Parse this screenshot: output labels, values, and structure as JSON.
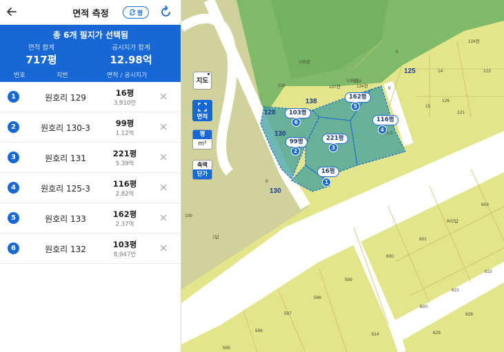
{
  "header": {
    "title": "면적 측정",
    "unit_toggle_label": "평"
  },
  "summary": {
    "title": "총 6개 필지가 선택됨",
    "area_label": "면적 합계",
    "area_value": "717평",
    "price_label": "공시지가 합계",
    "price_value": "12.98억",
    "col_number": "번호",
    "col_jibun": "지번",
    "col_area_price": "면적 / 공시지가"
  },
  "parcels": [
    {
      "number": "1",
      "jibun": "원호리 129",
      "area": "16평",
      "price": "3,910만"
    },
    {
      "number": "2",
      "jibun": "원호리 130-3",
      "area": "99평",
      "price": "1.12억"
    },
    {
      "number": "3",
      "jibun": "원호리 131",
      "area": "221평",
      "price": "5.39억"
    },
    {
      "number": "4",
      "jibun": "원호리 125-3",
      "area": "116평",
      "price": "2.82억"
    },
    {
      "number": "5",
      "jibun": "원호리 133",
      "area": "162평",
      "price": "2.37억"
    },
    {
      "number": "6",
      "jibun": "원호리 132",
      "area": "103평",
      "price": "8,947만"
    }
  ],
  "map_controls": {
    "map_button": "지도",
    "area_button": "면적",
    "unit_selected": "평",
    "unit_other": "m²",
    "zoom_top": "축액",
    "zoom_bottom": "단가"
  },
  "map_labels": {
    "block_128": "128",
    "block_138": "138",
    "block_130": "130",
    "block_125": "125",
    "block_130_road": "130",
    "lot_135": "135전",
    "lot_137": "137전",
    "lot_138_small": "138",
    "lot_123": "123",
    "lot_124": "124전",
    "lot_14": "14",
    "lot_125_3": "125-3",
    "lot_126": "126",
    "lot_121": "121",
    "lot_603": "603",
    "lot_602": "602답",
    "lot_601": "601",
    "lot_600": "600",
    "lot_599": "599",
    "lot_598": "598",
    "lot_597": "597",
    "lot_596": "596",
    "lot_595": "595",
    "lot_614": "614",
    "lot_620": "620",
    "lot_621": "621",
    "lot_622": "622",
    "lot_628": "628",
    "lot_629": "629",
    "lot_199": "199",
    "lot_8": "8",
    "lot_1": "1답",
    "lot_5": "5",
    "lot_9": "9",
    "lot_15": "15",
    "lot_133": "133",
    "lot_134": "134전",
    "lot_135b": "135전"
  },
  "map_pills": [
    {
      "label": "103평",
      "badge": "6"
    },
    {
      "label": "162평",
      "badge": "5"
    },
    {
      "label": "116평",
      "badge": "4"
    },
    {
      "label": "99평",
      "badge": "2"
    },
    {
      "label": "221평",
      "badge": "3"
    },
    {
      "label": "16평",
      "badge": "1"
    }
  ],
  "colors": {
    "accent": "#1767d4",
    "map_yellow": "#e3e58a",
    "map_green": "#7fba6a",
    "selected_fill": "#3f9f9c"
  }
}
